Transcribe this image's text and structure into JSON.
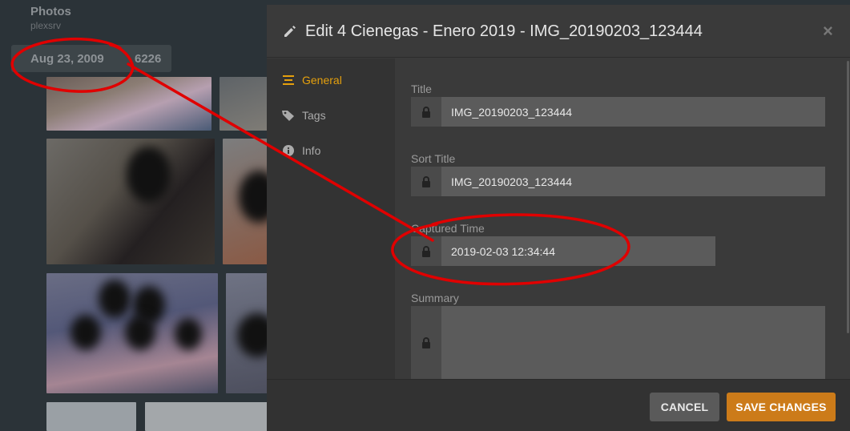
{
  "library": {
    "title": "Photos",
    "server": "plexsrv",
    "date_label": "Aug 23, 2009",
    "count_fragment": "6226"
  },
  "modal": {
    "title": "Edit 4 Cienegas - Enero 2019 - IMG_20190203_123444",
    "close_label": "×",
    "sidebar": [
      {
        "label": "General",
        "icon": "list-icon",
        "active": true
      },
      {
        "label": "Tags",
        "icon": "tag-icon",
        "active": false
      },
      {
        "label": "Info",
        "icon": "info-icon",
        "active": false
      }
    ],
    "fields": {
      "title": {
        "label": "Title",
        "value": "IMG_20190203_123444"
      },
      "sort_title": {
        "label": "Sort Title",
        "value": "IMG_20190203_123444"
      },
      "captured_time": {
        "label": "Captured Time",
        "value": "2019-02-03 12:34:44"
      },
      "summary": {
        "label": "Summary",
        "value": ""
      }
    },
    "buttons": {
      "cancel": "CANCEL",
      "save": "SAVE CHANGES"
    }
  },
  "colors": {
    "accent": "#e5a00d",
    "save_button": "#cc7b19",
    "annotation": "#e00000"
  }
}
